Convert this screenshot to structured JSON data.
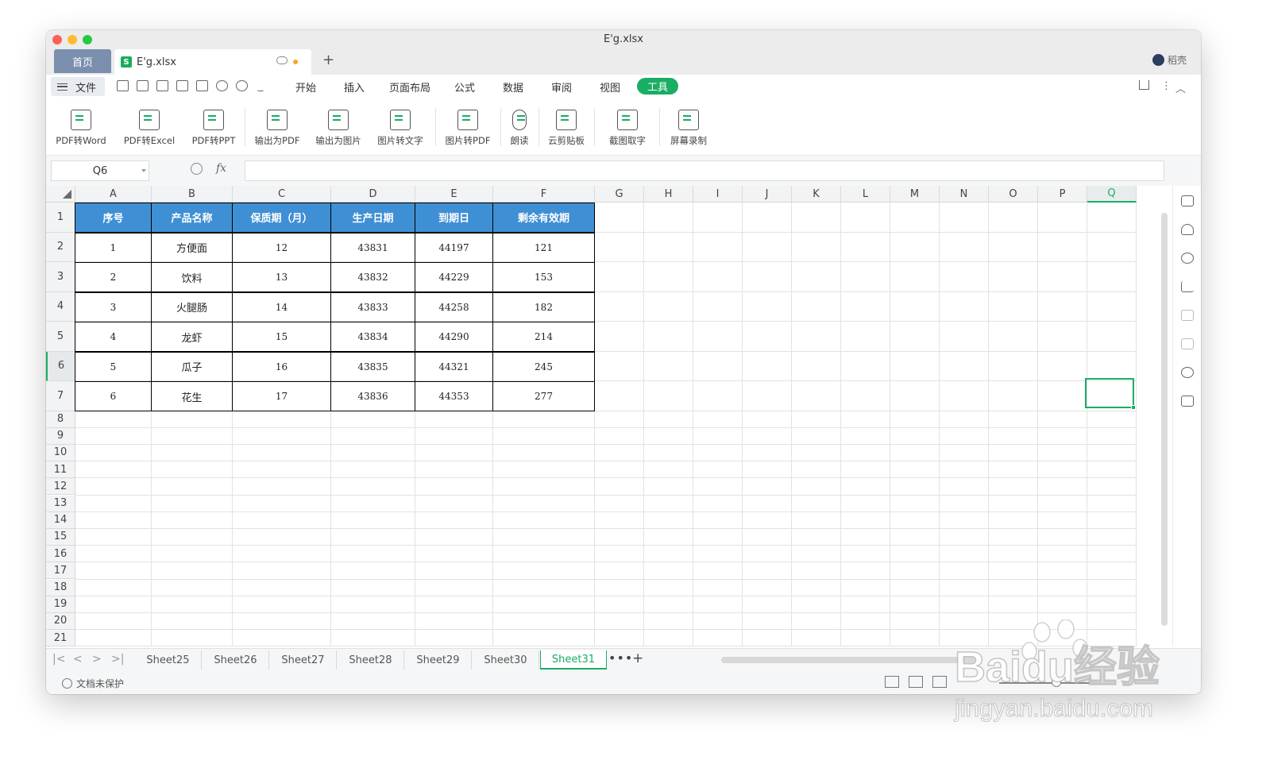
{
  "window": {
    "title": "E'g.xlsx"
  },
  "tabs": {
    "home": "首页",
    "file": "E'g.xlsx",
    "file_icon": "S",
    "add": "+",
    "user": "稻壳"
  },
  "menu": {
    "file_label": "文件",
    "items": [
      "开始",
      "插入",
      "页面布局",
      "公式",
      "数据",
      "审阅",
      "视图"
    ],
    "active": "工具"
  },
  "toolbar": {
    "tools": [
      "PDF转Word",
      "PDF转Excel",
      "PDF转PPT",
      "输出为PDF",
      "输出为图片",
      "图片转文字",
      "图片转PDF",
      "朗读",
      "云剪贴板",
      "截图取字",
      "屏幕录制"
    ]
  },
  "formula": {
    "cell_ref": "Q6",
    "fx": "fx",
    "value": ""
  },
  "sheet": {
    "columns": [
      "A",
      "B",
      "C",
      "D",
      "E",
      "F",
      "G",
      "H",
      "I",
      "J",
      "K",
      "L",
      "M",
      "N",
      "O",
      "P",
      "Q"
    ],
    "active_column": "Q",
    "rows": [
      "1",
      "2",
      "3",
      "4",
      "5",
      "6",
      "7",
      "8",
      "9",
      "10",
      "11",
      "12",
      "13",
      "14",
      "15",
      "16",
      "17",
      "18",
      "19",
      "20",
      "21"
    ],
    "active_row": "6",
    "table_headers": [
      "序号",
      "产品名称",
      "保质期（月）",
      "生产日期",
      "到期日",
      "剩余有效期"
    ],
    "table_rows": [
      [
        "1",
        "方便面",
        "12",
        "43831",
        "44197",
        "121"
      ],
      [
        "2",
        "饮料",
        "13",
        "43832",
        "44229",
        "153"
      ],
      [
        "3",
        "火腿肠",
        "14",
        "43833",
        "44258",
        "182"
      ],
      [
        "4",
        "龙虾",
        "15",
        "43834",
        "44290",
        "214"
      ],
      [
        "5",
        "瓜子",
        "16",
        "43835",
        "44321",
        "245"
      ],
      [
        "6",
        "花生",
        "17",
        "43836",
        "44353",
        "277"
      ]
    ],
    "header_color": "#3f8fd4",
    "selection_color": "#1aad64"
  },
  "sheet_tabs": {
    "names": [
      "Sheet25",
      "Sheet26",
      "Sheet27",
      "Sheet28",
      "Sheet29",
      "Sheet30",
      "Sheet31"
    ],
    "active": "Sheet31",
    "more": "•••",
    "add": "+"
  },
  "status": {
    "protection": "文档未保护"
  },
  "watermark": {
    "brand": "Baidu经验",
    "url": "jingyan.baidu.com"
  }
}
